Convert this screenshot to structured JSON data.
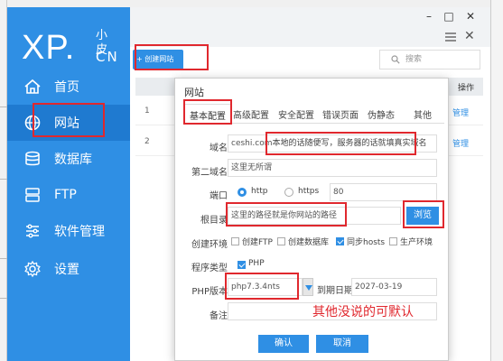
{
  "app": {
    "logo_main": "XP.",
    "logo_sub": "小皮",
    "logo_cn": "CN"
  },
  "sidebar": {
    "items": [
      {
        "label": "首页",
        "icon": "home-icon"
      },
      {
        "label": "网站",
        "icon": "globe-icon"
      },
      {
        "label": "数据库",
        "icon": "database-icon"
      },
      {
        "label": "FTP",
        "icon": "server-icon"
      },
      {
        "label": "软件管理",
        "icon": "sliders-icon"
      },
      {
        "label": "设置",
        "icon": "gear-icon"
      }
    ]
  },
  "window": {
    "min": "–",
    "max": "□",
    "close": "✕"
  },
  "toolbar": {
    "add_site": "+ 创建网站",
    "search_placeholder": "搜索",
    "close": "✕"
  },
  "table": {
    "ops_header": "操作",
    "rows": [
      {
        "num": "1",
        "manage": "管理"
      },
      {
        "num": "2",
        "manage": "管理"
      }
    ]
  },
  "modal": {
    "title": "网站",
    "tabs": [
      "基本配置",
      "高级配置",
      "安全配置",
      "错误页面",
      "伪静态",
      "其他"
    ],
    "fields": {
      "domain_label": "域名",
      "domain_value": "ceshi.com",
      "domain_hint": "本地的话随便写，服务器的话就填真实域名",
      "second_domain_label": "第二域名",
      "second_domain_value": "这里无所谓",
      "port_label": "端口",
      "http_label": "http",
      "https_label": "https",
      "port_value": "80",
      "root_label": "根目录",
      "root_value": "这里的路径就是你网站的路径",
      "browse": "浏览",
      "env_label": "创建环境",
      "env_options": [
        {
          "label": "创建FTP",
          "checked": false
        },
        {
          "label": "创建数据库",
          "checked": false
        },
        {
          "label": "同步hosts",
          "checked": true
        },
        {
          "label": "生产环境",
          "checked": false
        }
      ],
      "prog_type_label": "程序类型",
      "prog_type_value": "PHP",
      "php_label": "PHP版本",
      "php_value": "php7.3.4nts",
      "expire_label": "到期日期",
      "expire_value": "2027-03-19",
      "remark_label": "备注"
    },
    "note": "其他没说的可默认",
    "confirm": "确认",
    "cancel": "取消"
  },
  "colors": {
    "accent": "#2f8fe4",
    "annotation": "#e0282e"
  }
}
